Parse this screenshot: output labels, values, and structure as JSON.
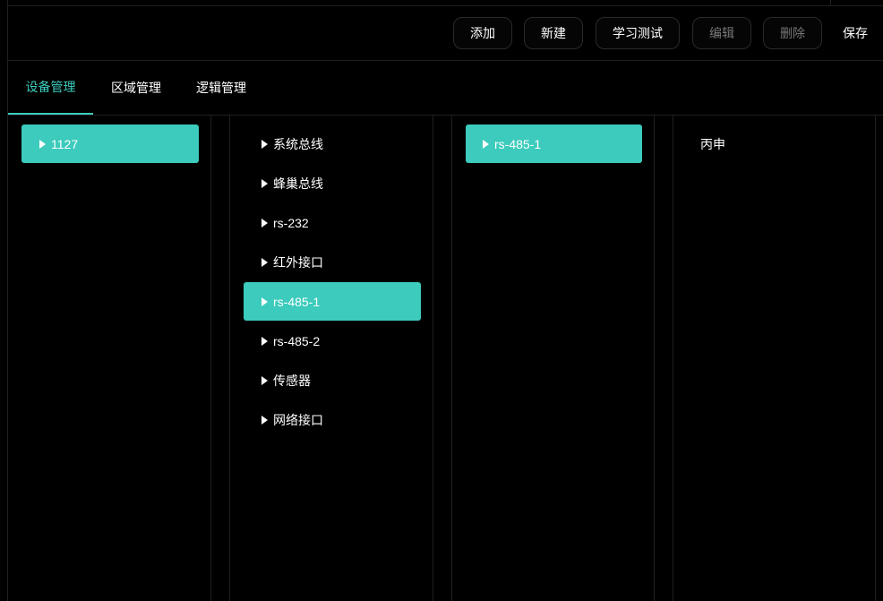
{
  "toolbar": {
    "buttons": [
      {
        "label": "添加",
        "state": "enabled"
      },
      {
        "label": "新建",
        "state": "enabled"
      },
      {
        "label": "学习测试",
        "state": "enabled"
      },
      {
        "label": "编辑",
        "state": "disabled"
      },
      {
        "label": "删除",
        "state": "disabled"
      },
      {
        "label": "保存",
        "state": "enabled"
      }
    ]
  },
  "tabs": [
    {
      "label": "设备管理",
      "active": true
    },
    {
      "label": "区域管理",
      "active": false
    },
    {
      "label": "逻辑管理",
      "active": false
    }
  ],
  "columns": {
    "devices": [
      {
        "label": "1127",
        "selected": true
      }
    ],
    "buses": [
      {
        "label": "系统总线",
        "selected": false
      },
      {
        "label": "蜂巢总线",
        "selected": false
      },
      {
        "label": "rs-232",
        "selected": false
      },
      {
        "label": "红外接口",
        "selected": false
      },
      {
        "label": "rs-485-1",
        "selected": true
      },
      {
        "label": "rs-485-2",
        "selected": false
      },
      {
        "label": "传感器",
        "selected": false
      },
      {
        "label": "网络接口",
        "selected": false
      }
    ],
    "ports": [
      {
        "label": "rs-485-1",
        "selected": true
      }
    ],
    "items": [
      {
        "label": "丙申"
      }
    ]
  },
  "colors": {
    "accent": "#3ccbbc",
    "background": "#000000",
    "border": "#1f1f1f"
  }
}
